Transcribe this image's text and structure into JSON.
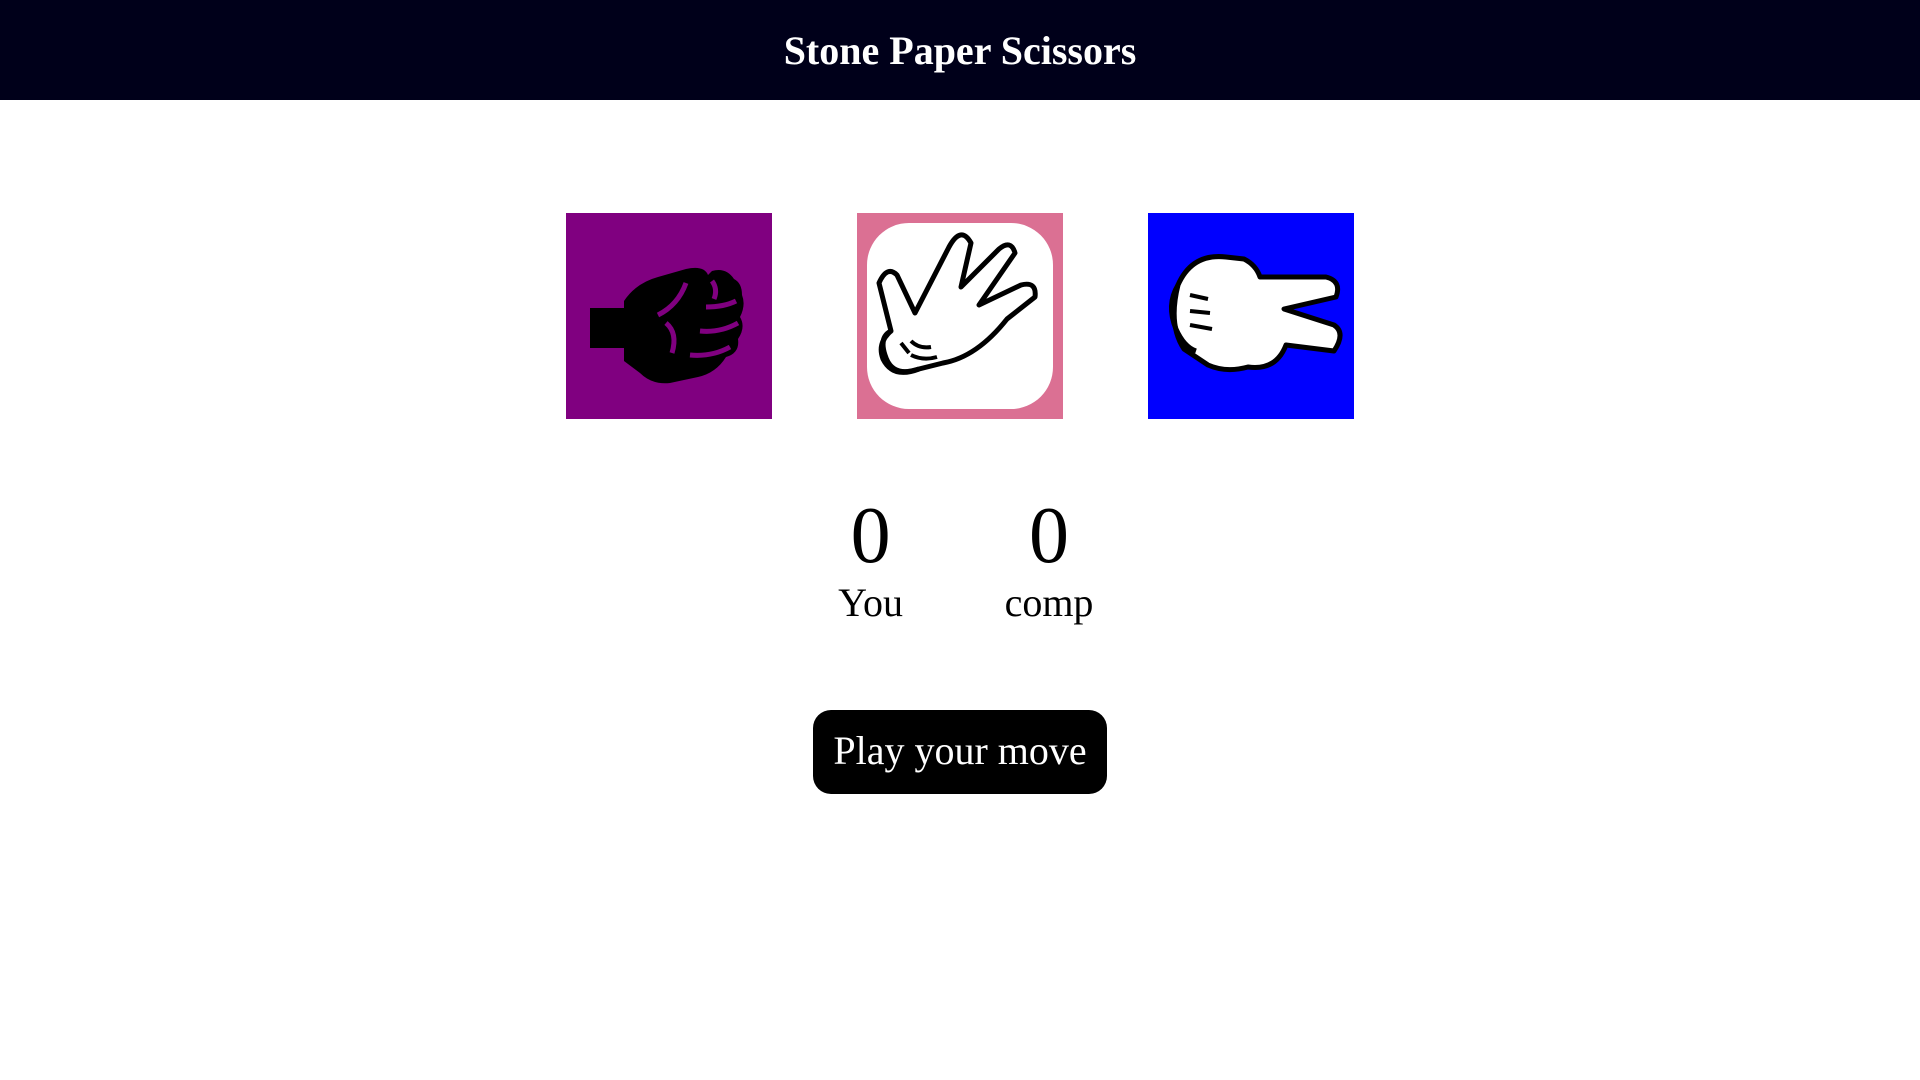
{
  "header": {
    "title": "Stone Paper Scissors"
  },
  "choices": [
    {
      "id": "rock",
      "icon": "fist-icon",
      "color": "#800080"
    },
    {
      "id": "paper",
      "icon": "open-hand-icon",
      "color": "#db7093"
    },
    {
      "id": "scissors",
      "icon": "two-finger-hand-icon",
      "color": "#0000ff"
    }
  ],
  "scores": {
    "user": {
      "value": "0",
      "label": "You"
    },
    "comp": {
      "value": "0",
      "label": "comp"
    }
  },
  "message": "Play your move",
  "colors": {
    "header_bg": "#00001a",
    "message_bg": "#000000"
  }
}
